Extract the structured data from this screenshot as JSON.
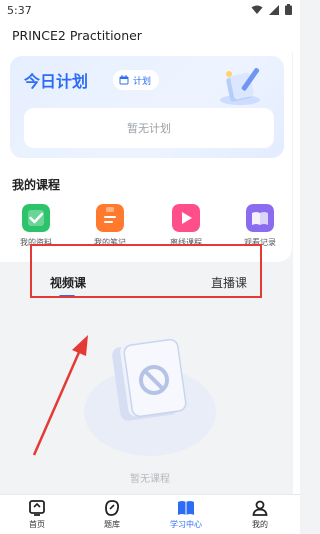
{
  "status": {
    "time": "5:37"
  },
  "header": {
    "title": "PRINCE2 Practitioner"
  },
  "plan": {
    "title": "今日计划",
    "chip_label": "计划",
    "empty_text": "暂无计划"
  },
  "courses": {
    "section_title": "我的课程",
    "items": [
      {
        "label": "我的资料",
        "color": "#2cc36b"
      },
      {
        "label": "我的笔记",
        "color": "#ff7a2f"
      },
      {
        "label": "离线课程",
        "color": "#ff4f8b"
      },
      {
        "label": "观看记录",
        "color": "#8b6cf0"
      }
    ]
  },
  "tabs": [
    {
      "label": "视频课",
      "active": true
    },
    {
      "label": "直播课",
      "active": false
    }
  ],
  "empty": {
    "text": "暂无课程"
  },
  "nav": [
    {
      "label": "首页",
      "icon": "home-icon"
    },
    {
      "label": "题库",
      "icon": "question-bank-icon"
    },
    {
      "label": "学习中心",
      "icon": "study-center-icon",
      "active": true
    },
    {
      "label": "我的",
      "icon": "profile-icon"
    }
  ],
  "colors": {
    "accent": "#2d6df6",
    "highlight": "#e53935"
  }
}
